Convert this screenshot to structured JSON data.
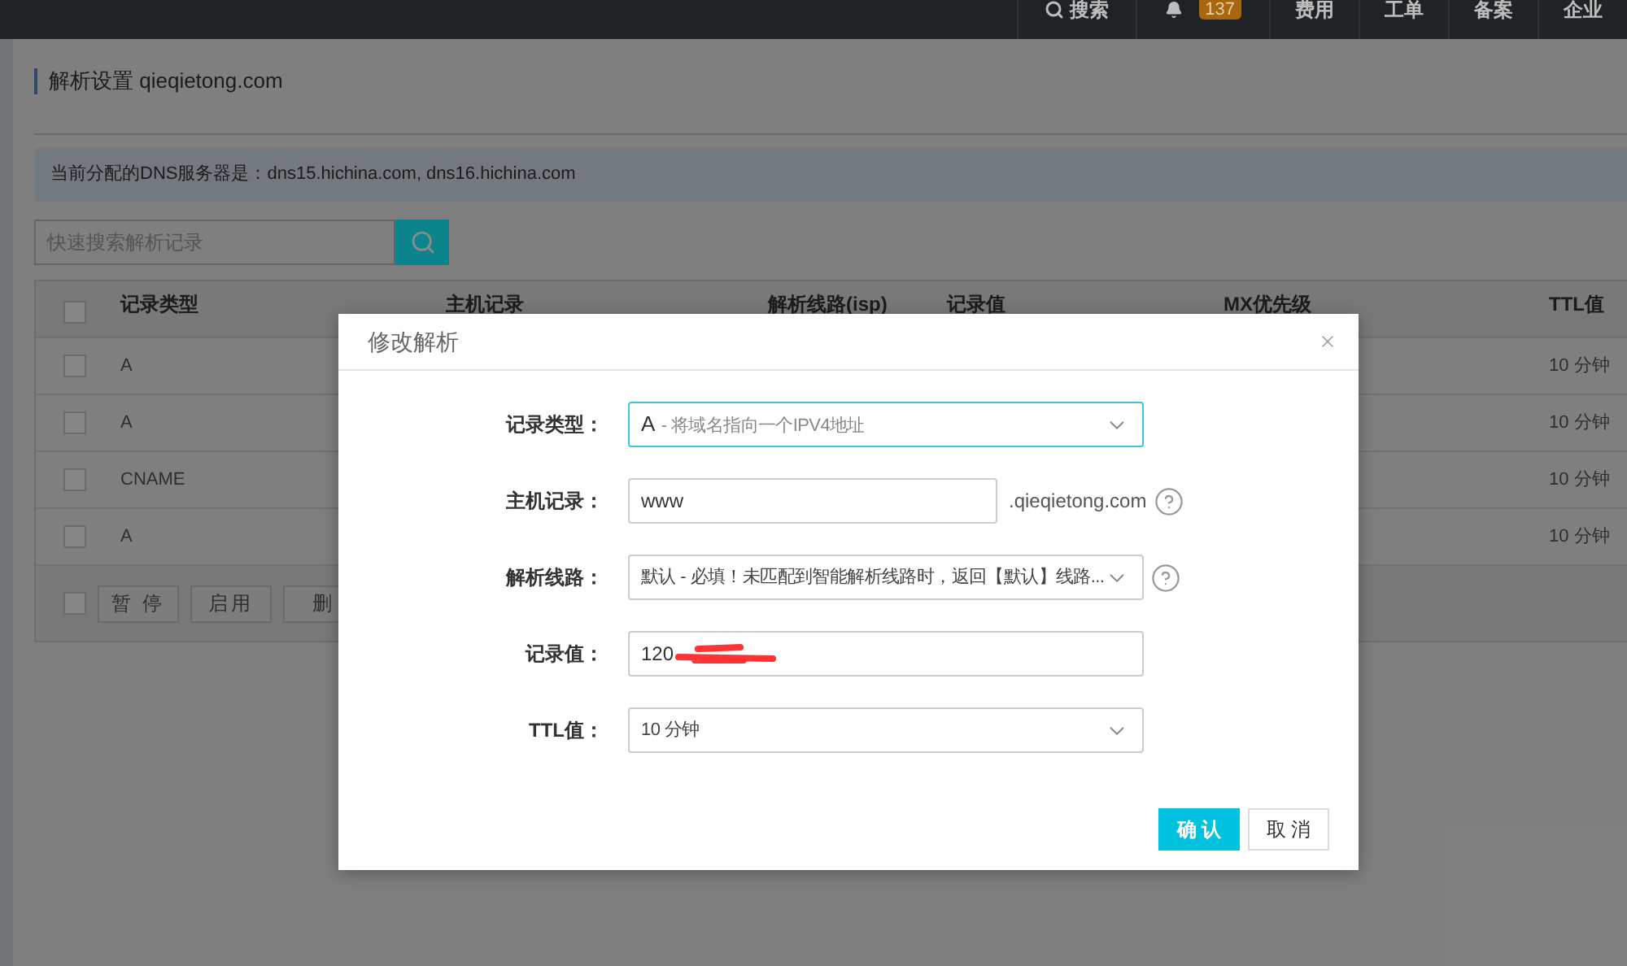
{
  "top_nav": [
    {
      "kind": "search",
      "label": "搜索"
    },
    {
      "kind": "notifications",
      "badge": "137"
    },
    {
      "kind": "link",
      "label": "费用"
    },
    {
      "kind": "link",
      "label": "工单"
    },
    {
      "kind": "link",
      "label": "备案"
    },
    {
      "kind": "link",
      "label": "企业"
    }
  ],
  "page_title": "解析设置 qieqietong.com",
  "dns_notice": "当前分配的DNS服务器是：dns15.hichina.com, dns16.hichina.com",
  "search": {
    "placeholder": "快速搜索解析记录"
  },
  "table": {
    "header_checked": false,
    "columns": [
      "记录类型",
      "主机记录",
      "解析线路(isp)",
      "记录值",
      "MX优先级",
      "TTL值"
    ],
    "rows": [
      {
        "checked": false,
        "type": "A",
        "ttl": "10 分钟"
      },
      {
        "checked": false,
        "type": "A",
        "ttl": "10 分钟"
      },
      {
        "checked": false,
        "type": "CNAME",
        "ttl": "10 分钟"
      },
      {
        "checked": false,
        "type": "A",
        "ttl": "10 分钟"
      }
    ],
    "footer": {
      "checked": false,
      "buttons": [
        "暂 停",
        "启用",
        "删"
      ]
    }
  },
  "dialog": {
    "title": "修改解析",
    "fields": [
      {
        "kind": "select",
        "label": "记录类型：",
        "value": "A",
        "hint": "- 将域名指向一个IPV4地址",
        "focused": true,
        "help": false,
        "redacted": false
      },
      {
        "kind": "input",
        "label": "主机记录：",
        "value": "www",
        "suffix": ".qieqietong.com",
        "focused": false,
        "help": true,
        "redacted": false
      },
      {
        "kind": "select",
        "label": "解析线路：",
        "value": "默认 - 必填！未匹配到智能解析线路时，返回【默认】线路...",
        "focused": false,
        "help": true,
        "redacted": false
      },
      {
        "kind": "input",
        "label": "记录值：",
        "value": "120",
        "focused": false,
        "help": false,
        "redacted": true
      },
      {
        "kind": "select",
        "label": "TTL值：",
        "value": "10 分钟",
        "focused": false,
        "help": false,
        "redacted": false
      }
    ],
    "buttons": [
      {
        "label": "确 认",
        "primary": true
      },
      {
        "label": "取 消",
        "primary": false
      }
    ]
  }
}
